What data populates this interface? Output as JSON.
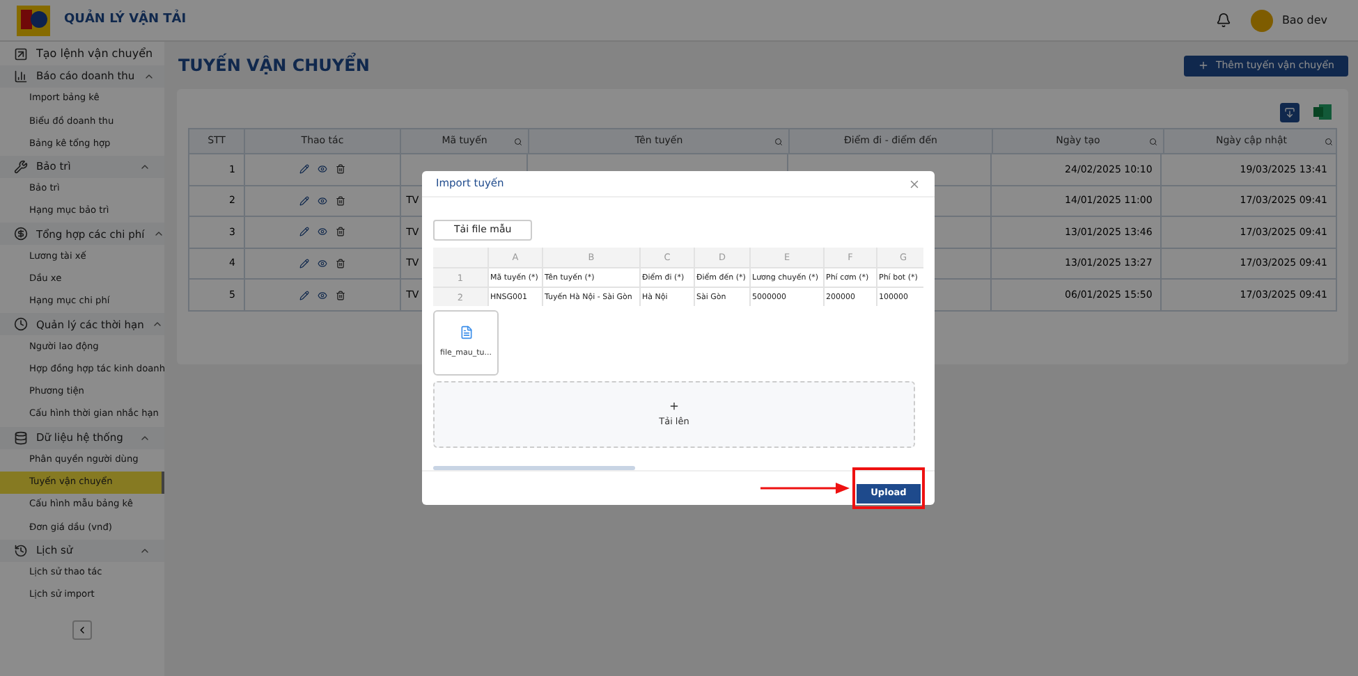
{
  "header": {
    "app_title": "QUẢN LÝ VẬN TẢI",
    "user_name": "Bao dev"
  },
  "sidebar": {
    "items": [
      {
        "kind": "link",
        "label": "Tạo lệnh vận chuyển"
      },
      {
        "kind": "group",
        "label": "Báo cáo doanh thu",
        "expanded": true,
        "children": [
          {
            "label": "Import bảng kê",
            "selected": false
          },
          {
            "label": "Biểu đồ doanh thu",
            "selected": false
          },
          {
            "label": "Bảng kê tổng hợp",
            "selected": false
          }
        ]
      },
      {
        "kind": "group",
        "label": "Bảo trì",
        "expanded": true,
        "children": [
          {
            "label": "Bảo trì",
            "selected": false
          },
          {
            "label": "Hạng mục bảo trì",
            "selected": false
          }
        ]
      },
      {
        "kind": "group",
        "label": "Tổng hợp các chi phí",
        "expanded": true,
        "children": [
          {
            "label": "Lương tài xế",
            "selected": false
          },
          {
            "label": "Dầu xe",
            "selected": false
          },
          {
            "label": "Hạng mục chi phí",
            "selected": false
          }
        ]
      },
      {
        "kind": "group",
        "label": "Quản lý các thời hạn",
        "expanded": true,
        "children": [
          {
            "label": "Người lao động",
            "selected": false
          },
          {
            "label": "Hợp đồng hợp tác kinh doanh",
            "selected": false
          },
          {
            "label": "Phương tiện",
            "selected": false
          },
          {
            "label": "Cấu hình thời gian nhắc hạn",
            "selected": false
          }
        ]
      },
      {
        "kind": "group",
        "label": "Dữ liệu hệ thống",
        "expanded": true,
        "children": [
          {
            "label": "Phân quyền người dùng",
            "selected": false
          },
          {
            "label": "Tuyến vận chuyển",
            "selected": true
          },
          {
            "label": "Cấu hình mẫu bảng kê",
            "selected": false
          },
          {
            "label": "Đơn giá dầu (vnđ)",
            "selected": false
          }
        ]
      },
      {
        "kind": "group",
        "label": "Lịch sử",
        "expanded": true,
        "children": [
          {
            "label": "Lịch sử thao tác",
            "selected": false
          },
          {
            "label": "Lịch sử import",
            "selected": false
          }
        ]
      }
    ]
  },
  "page": {
    "title": "TUYẾN VẬN CHUYỂN",
    "add_button": "Thêm tuyến vận chuyển"
  },
  "table": {
    "columns": [
      {
        "label": "STT",
        "searchable": false
      },
      {
        "label": "Thao tác",
        "searchable": false
      },
      {
        "label": "Mã tuyến",
        "searchable": true
      },
      {
        "label": "Tên tuyến",
        "searchable": true
      },
      {
        "label": "Điểm đi - điểm đến",
        "searchable": false
      },
      {
        "label": "Ngày tạo",
        "searchable": true
      },
      {
        "label": "Ngày cập nhật",
        "searchable": true
      }
    ],
    "rows": [
      {
        "stt": "1",
        "created": "24/02/2025 10:10",
        "updated": "19/03/2025 13:41"
      },
      {
        "stt": "2",
        "code": "TV",
        "created": "14/01/2025 11:00",
        "updated": "17/03/2025 09:41"
      },
      {
        "stt": "3",
        "code": "TV",
        "created": "13/01/2025 13:46",
        "updated": "17/03/2025 09:41"
      },
      {
        "stt": "4",
        "code": "TV",
        "created": "13/01/2025 13:27",
        "updated": "17/03/2025 09:41"
      },
      {
        "stt": "5",
        "code": "TV",
        "created": "06/01/2025 15:50",
        "updated": "17/03/2025 09:41"
      }
    ]
  },
  "modal": {
    "title": "Import tuyến",
    "template_button": "Tải file mẫu",
    "sheet": {
      "columns": [
        "A",
        "B",
        "C",
        "D",
        "E",
        "F",
        "G"
      ],
      "rows": [
        {
          "num": "1",
          "cells": [
            "Mã tuyến (*)",
            "Tên tuyến (*)",
            "Điểm đi (*)",
            "Điểm đến (*)",
            "Lương chuyến (*)",
            "Phí cơm (*)",
            "Phí bot (*)"
          ]
        },
        {
          "num": "2",
          "cells": [
            "HNSG001",
            "Tuyến Hà Nội - Sài Gòn",
            "Hà Nội",
            "Sài Gòn",
            "5000000",
            "200000",
            "100000"
          ]
        }
      ]
    },
    "file_name": "file_mau_tu...",
    "upload_area_label": "Tải lên",
    "upload_button": "Upload"
  }
}
